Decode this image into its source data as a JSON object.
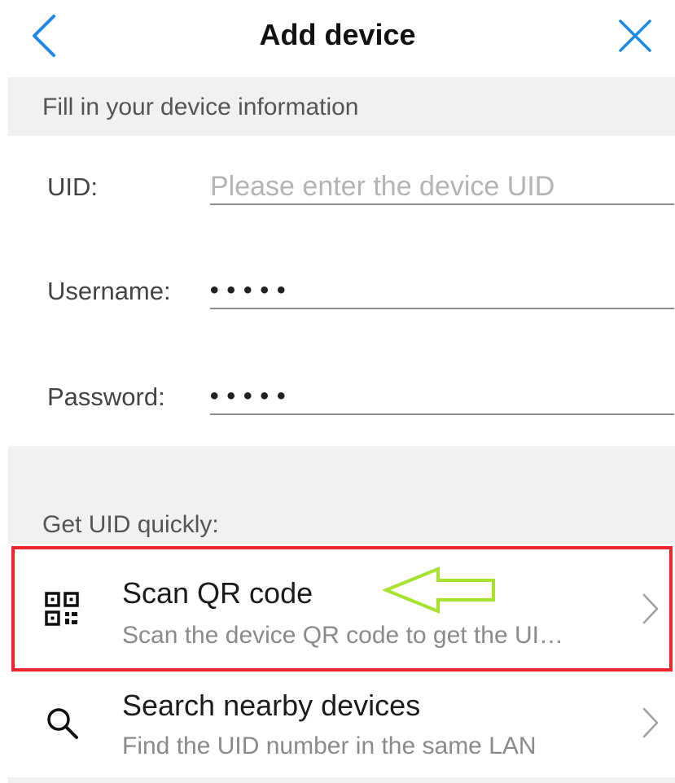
{
  "header": {
    "title": "Add device",
    "back_icon": "chevron-left-icon",
    "close_icon": "close-icon"
  },
  "device_info": {
    "section_label": "Fill in your device information",
    "uid": {
      "label": "UID:",
      "placeholder": "Please enter the device UID",
      "value": ""
    },
    "username": {
      "label": "Username:",
      "masked_value": "•••••"
    },
    "password": {
      "label": "Password:",
      "masked_value": "•••••"
    }
  },
  "quick_uid": {
    "section_label": "Get UID quickly:",
    "items": [
      {
        "title": "Scan QR code",
        "subtitle": "Scan the device QR code to get the UI…",
        "icon": "qr-code-icon"
      },
      {
        "title": "Search nearby devices",
        "subtitle": "Find the UID number in the same LAN",
        "icon": "search-icon"
      }
    ]
  },
  "colors": {
    "accent": "#1e88e5",
    "highlight_border": "#e8262c",
    "annotation_arrow": "#a6e22e",
    "section_bg": "#f1f1f1"
  }
}
